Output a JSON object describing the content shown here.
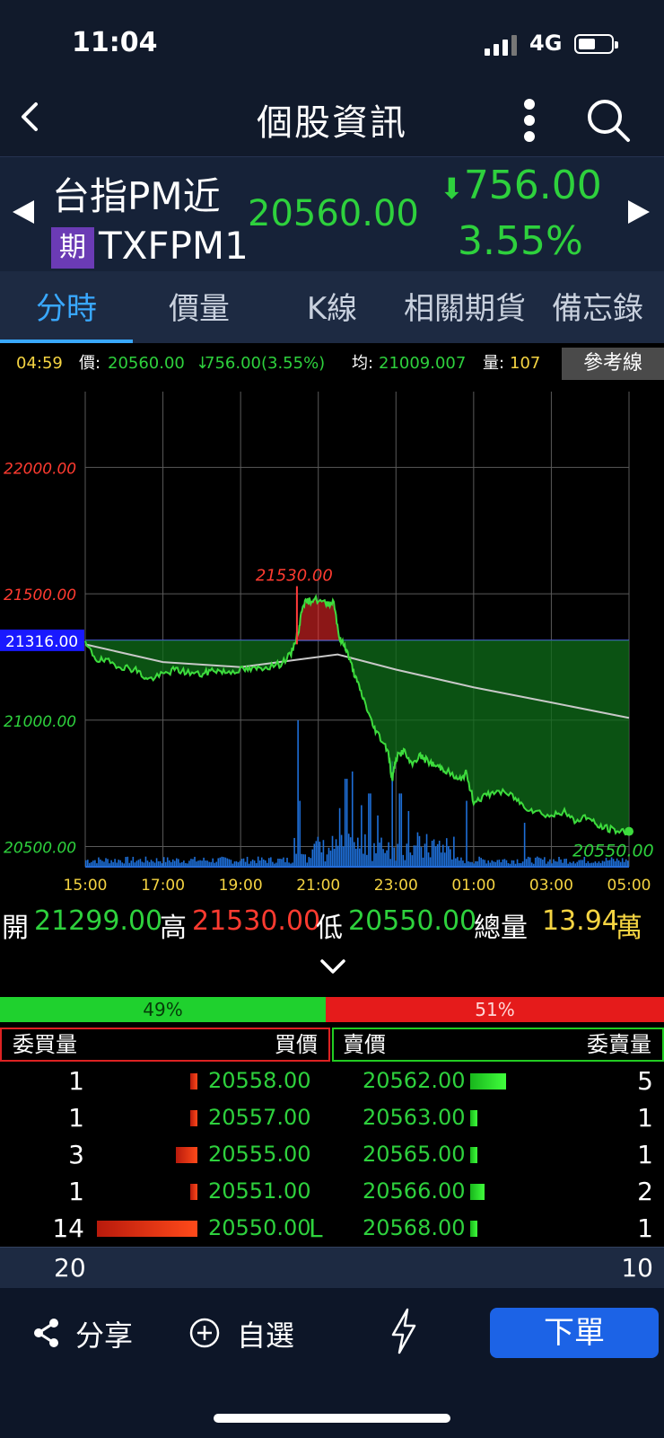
{
  "status": {
    "time": "11:04",
    "network": "4G"
  },
  "nav": {
    "title": "個股資訊"
  },
  "quote": {
    "name": "台指PM近",
    "badge": "期",
    "code": "TXFPM1",
    "price": "20560.00",
    "change": "756.00",
    "change_pct": "3.55%",
    "down_color": "#2ed13d",
    "up_color": "#ff3b30"
  },
  "tabs": [
    "分時",
    "價量",
    "K線",
    "相關期貨",
    "備忘錄"
  ],
  "info_bar": {
    "time": "04:59",
    "price_label": "價:",
    "price": "20560.00",
    "change": "756.00(3.55%)",
    "avg_label": "均:",
    "avg": "21009.007",
    "vol_label": "量:",
    "vol": "107",
    "ref_button": "參考線"
  },
  "chart_data": {
    "type": "line",
    "x_ticks": [
      "15:00",
      "17:00",
      "19:00",
      "21:00",
      "23:00",
      "01:00",
      "03:00",
      "05:00"
    ],
    "y_ticks": [
      "22000.00",
      "21500.00",
      "21000.00",
      "20500.00"
    ],
    "ylim": [
      20420,
      22300
    ],
    "reference_value": 21316,
    "reference_label": "21316.00",
    "high_label": "21530.00",
    "last_label": "20550.00",
    "price_series": {
      "x_hours": [
        0,
        0.3,
        0.6,
        1.0,
        1.3,
        1.6,
        2.0,
        2.3,
        2.6,
        3.0,
        3.3,
        3.6,
        4.0,
        4.3,
        4.6,
        5.0,
        5.3,
        5.5,
        5.6,
        5.75,
        5.9,
        6.2,
        6.4,
        6.55,
        6.7,
        6.85,
        7.0,
        7.2,
        7.4,
        7.6,
        7.8,
        7.9,
        8.0,
        8.2,
        8.4,
        8.6,
        8.8,
        9.0,
        9.2,
        9.4,
        9.6,
        9.8,
        10.0,
        10.3,
        10.6,
        11.0,
        11.3,
        11.6,
        12.0,
        12.3,
        12.6,
        12.9,
        13.2,
        13.5,
        13.75,
        14.0
      ],
      "values": [
        21300,
        21240,
        21230,
        21210,
        21200,
        21160,
        21180,
        21200,
        21190,
        21180,
        21200,
        21190,
        21200,
        21200,
        21210,
        21220,
        21260,
        21360,
        21460,
        21470,
        21480,
        21460,
        21470,
        21320,
        21290,
        21220,
        21150,
        21070,
        20980,
        20930,
        20880,
        20760,
        20850,
        20880,
        20820,
        20860,
        20840,
        20820,
        20810,
        20790,
        20760,
        20790,
        20680,
        20700,
        20720,
        20700,
        20660,
        20640,
        20620,
        20640,
        20600,
        20620,
        20580,
        20570,
        20560,
        20560
      ]
    },
    "avg_series": {
      "x_hours": [
        0,
        2,
        4,
        5.5,
        6.5,
        8,
        10,
        12,
        14
      ],
      "values": [
        21300,
        21230,
        21210,
        21240,
        21260,
        21200,
        21130,
        21070,
        21009
      ]
    },
    "volume_peaks": {
      "x_hours": [
        5.45,
        5.52,
        6.55,
        6.7,
        6.85,
        7.1,
        7.3,
        7.5,
        7.9,
        8.1,
        8.3,
        9.8,
        11.3
      ],
      "values": [
        1.0,
        0.45,
        0.4,
        0.6,
        0.65,
        0.42,
        0.5,
        0.35,
        0.72,
        0.5,
        0.38,
        0.45,
        0.3
      ]
    },
    "colors": {
      "price_line": "#3ddc3d",
      "avg_line": "#c8c8c8",
      "fill_above": "#ff2a2a",
      "fill_below": "#0f6e1a",
      "volume": "#1e6fd8",
      "grid": "#5a5a5a"
    }
  },
  "ohlc": {
    "open_label": "開",
    "open": "21299.00",
    "high_label": "高",
    "high": "21530.00",
    "low_label": "低",
    "low": "20550.00",
    "vol_label": "總量",
    "vol": "13.94",
    "vol_unit": "萬"
  },
  "ratio": {
    "buy_pct": "49%",
    "sell_pct": "51%",
    "buy_value": 0.49
  },
  "order_book": {
    "headers": {
      "buy_qty": "委買量",
      "buy_price": "買價",
      "sell_price": "賣價",
      "sell_qty": "委賣量"
    },
    "rows": [
      {
        "buy_qty": "1",
        "buy_price": "20558.00",
        "sell_price": "20562.00",
        "sell_qty": "5",
        "limit_mark": ""
      },
      {
        "buy_qty": "1",
        "buy_price": "20557.00",
        "sell_price": "20563.00",
        "sell_qty": "1",
        "limit_mark": ""
      },
      {
        "buy_qty": "3",
        "buy_price": "20555.00",
        "sell_price": "20565.00",
        "sell_qty": "1",
        "limit_mark": ""
      },
      {
        "buy_qty": "1",
        "buy_price": "20551.00",
        "sell_price": "20566.00",
        "sell_qty": "2",
        "limit_mark": ""
      },
      {
        "buy_qty": "14",
        "buy_price": "20550.00",
        "sell_price": "20568.00",
        "sell_qty": "1",
        "limit_mark": "L"
      }
    ],
    "buy_total": "20",
    "sell_total": "10"
  },
  "bottom_bar": {
    "share": "分享",
    "watchlist": "自選",
    "order": "下單"
  }
}
